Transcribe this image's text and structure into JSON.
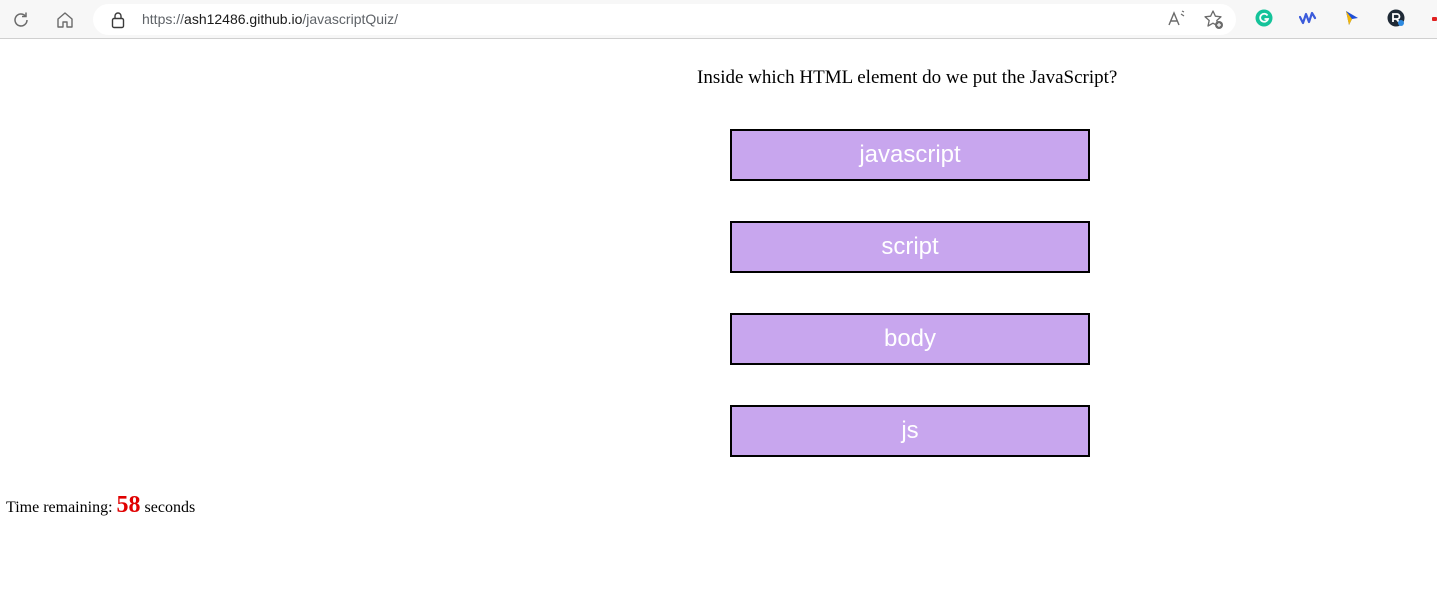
{
  "browser": {
    "url": {
      "scheme": "https://",
      "host": "ash12486.github.io",
      "path": "/javascriptQuiz/"
    },
    "icons": [
      "reload-icon",
      "home-icon",
      "lock-icon",
      "read-aloud-icon",
      "favorite-icon"
    ],
    "extensions": [
      "grammarly-icon",
      "wave-icon",
      "pointer-icon",
      "r-icon"
    ],
    "colors": {
      "grammarly": "#15c39a",
      "wave": "#3b5bdb",
      "accent_red": "#e02020"
    }
  },
  "quiz": {
    "question": "Inside which HTML element do we put the JavaScript?",
    "answers": [
      "javascript",
      "script",
      "body",
      "js"
    ],
    "answer_color": "#c8a6ee",
    "timer": {
      "prefix": "Time remaining: ",
      "value": "58",
      "suffix": " seconds",
      "value_color": "#e00000"
    }
  }
}
